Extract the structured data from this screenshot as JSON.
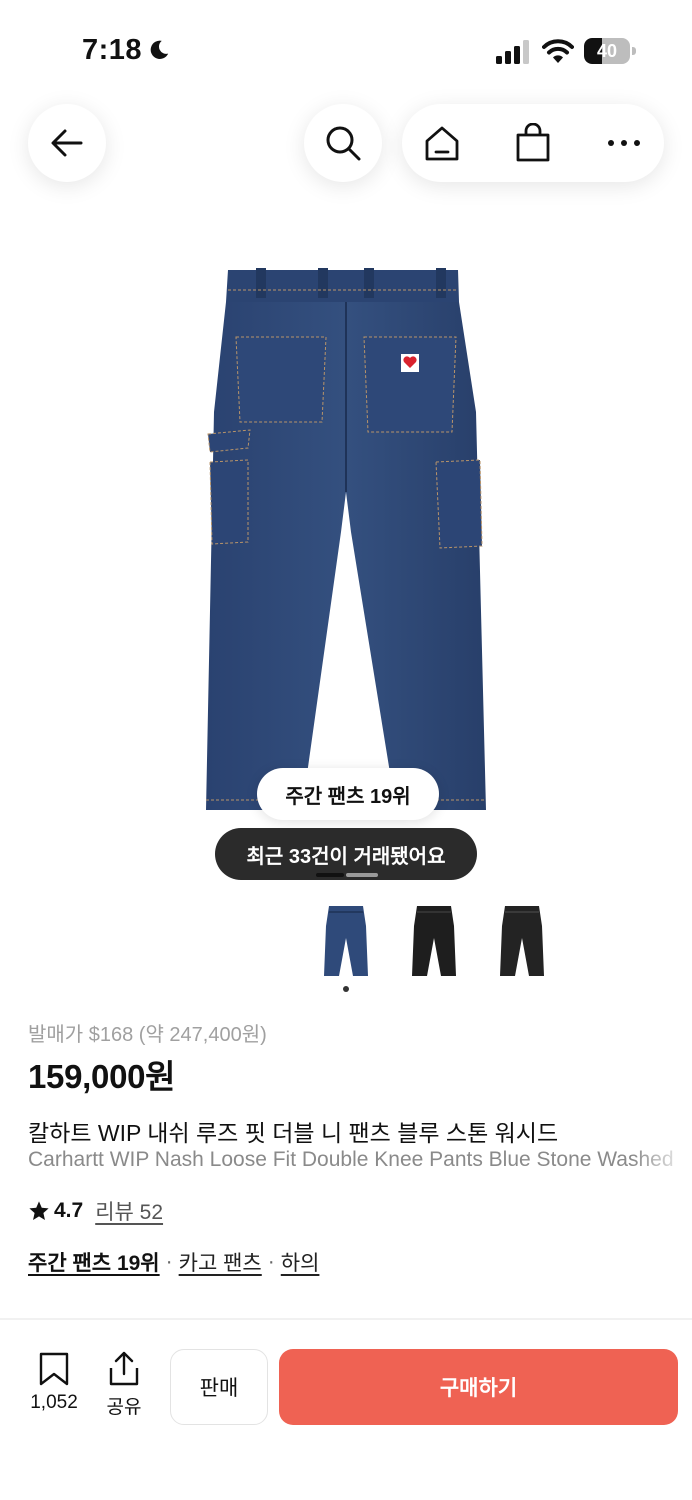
{
  "status_bar": {
    "time": "7:18",
    "battery": "40",
    "battery_level": 0.4
  },
  "nav": {
    "icons": [
      "back-arrow-icon",
      "search-icon",
      "home-icon",
      "shopping-bag-icon",
      "more-icon"
    ]
  },
  "product": {
    "rank_badge": "주간 팬츠 19위",
    "recent_trades": "최근 33건이 거래됐어요",
    "image_count": 3,
    "selected_image": 1,
    "release_price": "발매가 $168 (약 247,400원)",
    "price": "159,000원",
    "name_ko": "칼하트 WIP 내쉬 루즈 핏 더블 니 팬츠 블루 스톤 워시드",
    "name_en": "Carhartt WIP Nash Loose Fit Double Knee Pants Blue Stone Washed",
    "rating": "4.7",
    "review_link": "리뷰 52",
    "tags": {
      "rank": "주간 팬츠 19위",
      "separator": "·",
      "category": "카고 팬츠",
      "parent": "하의"
    },
    "colors": {
      "denim": "#2f4a7a",
      "black": "#1e1e1e"
    }
  },
  "bottom_bar": {
    "bookmark_count": "1,052",
    "share_label": "공유",
    "sell_label": "판매",
    "buy_label": "구매하기",
    "buy_color": "#ef6253"
  }
}
